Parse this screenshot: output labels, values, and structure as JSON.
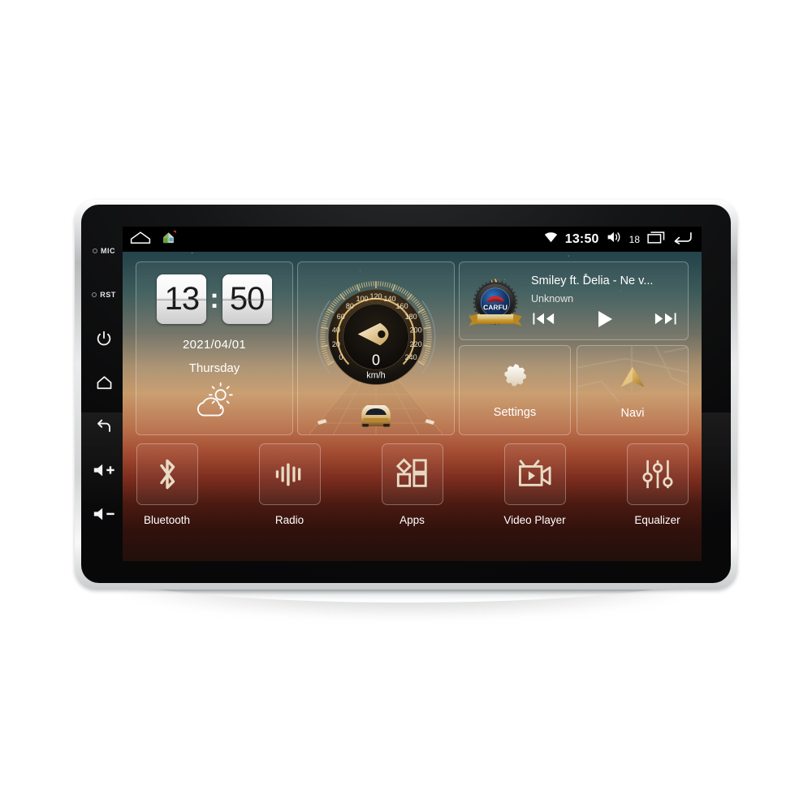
{
  "device": {
    "side_buttons": [
      {
        "name": "mic",
        "label": "MIC",
        "type": "hole"
      },
      {
        "name": "reset",
        "label": "RST",
        "type": "hole"
      },
      {
        "name": "power",
        "label": "",
        "icon": "power-icon"
      },
      {
        "name": "home",
        "label": "",
        "icon": "home-icon"
      },
      {
        "name": "back",
        "label": "",
        "icon": "back-icon"
      },
      {
        "name": "volume-up",
        "label": "+",
        "icon": "volume-up-icon"
      },
      {
        "name": "volume-down",
        "label": "-",
        "icon": "volume-down-icon"
      }
    ]
  },
  "statusbar": {
    "left_icons": [
      "arch-icon",
      "house-badge-icon"
    ],
    "wifi_icon": "wifi-icon",
    "time": "13:50",
    "volume_icon": "volume-icon",
    "volume_level": "18",
    "recents_icon": "recents-icon",
    "back_icon": "back-arrow-icon"
  },
  "clock_widget": {
    "hours": "13",
    "minutes": "50",
    "separator": ":",
    "date": "2021/04/01",
    "weekday": "Thursday",
    "weather_icon": "sun-behind-cloud-icon"
  },
  "speedometer_widget": {
    "value": "0",
    "unit": "km/h",
    "ticks": [
      "0",
      "20",
      "40",
      "60",
      "80",
      "100",
      "120",
      "140",
      "160",
      "180",
      "200",
      "220",
      "240"
    ],
    "min": 0,
    "max": 240,
    "needle_icon": "speedo-needle-icon",
    "car_icon": "car-on-road-icon"
  },
  "music_widget": {
    "logo_text": "CARFU",
    "logo_icon": "carfu-badge-icon",
    "track_title": "Smiley ft. Delia - Ne v...",
    "artist": "Unknown",
    "controls": [
      {
        "name": "previous-track-button",
        "icon": "skip-previous-icon"
      },
      {
        "name": "play-button",
        "icon": "play-icon"
      },
      {
        "name": "next-track-button",
        "icon": "skip-next-icon"
      }
    ]
  },
  "tiles": [
    {
      "name": "settings",
      "label": "Settings",
      "icon": "gear-icon"
    },
    {
      "name": "navi",
      "label": "Navi",
      "icon": "navigation-arrow-icon"
    }
  ],
  "dock": [
    {
      "name": "bluetooth",
      "label": "Bluetooth",
      "icon": "bluetooth-icon"
    },
    {
      "name": "radio",
      "label": "Radio",
      "icon": "radio-waveform-icon"
    },
    {
      "name": "apps",
      "label": "Apps",
      "icon": "apps-grid-icon"
    },
    {
      "name": "video-player",
      "label": "Video Player",
      "icon": "video-camera-icon"
    },
    {
      "name": "equalizer",
      "label": "Equalizer",
      "icon": "equalizer-sliders-icon"
    }
  ],
  "colors": {
    "sky_top": "#1d3a44",
    "horizon": "#c79a6a",
    "ground_bottom": "#23100b",
    "accent_gold": "#e8c98a",
    "panel_black": "#0a0a0b",
    "bezel_silver": "#e3e5e6",
    "text_white": "#ffffff"
  }
}
